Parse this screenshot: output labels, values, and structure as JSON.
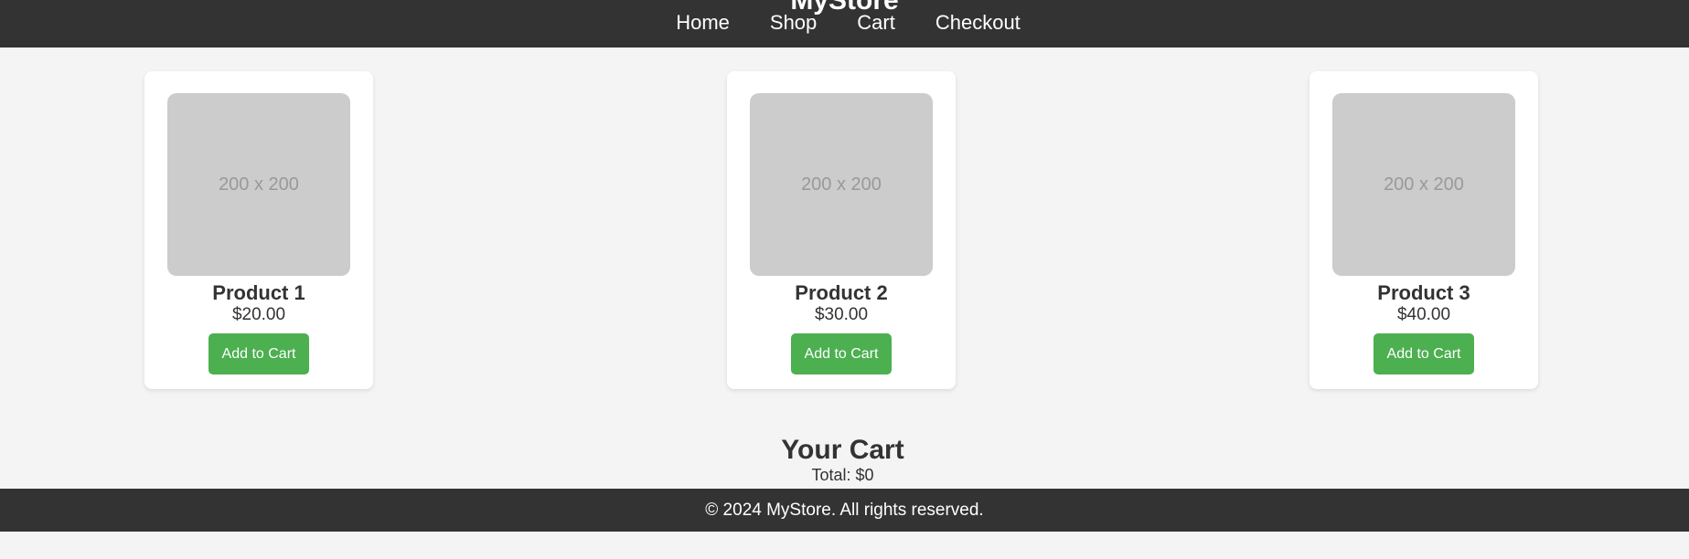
{
  "header": {
    "title": "MyStore",
    "nav": [
      "Home",
      "Shop",
      "Cart",
      "Checkout"
    ]
  },
  "products": [
    {
      "image_label": "200 x 200",
      "name": "Product 1",
      "price": "$20.00",
      "button": "Add to Cart"
    },
    {
      "image_label": "200 x 200",
      "name": "Product 2",
      "price": "$30.00",
      "button": "Add to Cart"
    },
    {
      "image_label": "200 x 200",
      "name": "Product 3",
      "price": "$40.00",
      "button": "Add to Cart"
    }
  ],
  "cart": {
    "title": "Your Cart",
    "total": "Total: $0"
  },
  "footer": {
    "text": "© 2024 MyStore. All rights reserved."
  },
  "colors": {
    "header_bg": "#333333",
    "button": "#4caf50",
    "page_bg": "#f4f4f4"
  }
}
